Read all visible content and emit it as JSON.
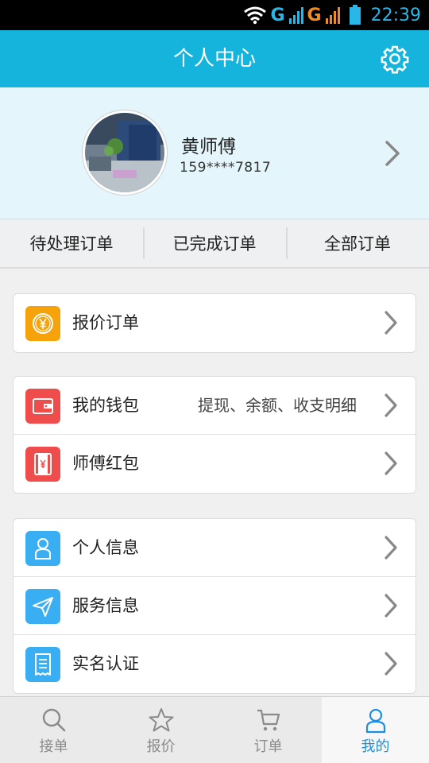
{
  "status_bar": {
    "network_1": "G",
    "network_2": "G",
    "time": "22:39"
  },
  "header": {
    "title": "个人中心",
    "settings_icon": "gear-icon"
  },
  "profile": {
    "name": "黄师傅",
    "phone": "159****7817"
  },
  "order_tabs": [
    {
      "label": "待处理订单"
    },
    {
      "label": "已完成订单"
    },
    {
      "label": "全部订单"
    }
  ],
  "groups": [
    {
      "items": [
        {
          "label": "报价订单",
          "icon": "yen-coin-icon",
          "color": "#f5a20b"
        }
      ]
    },
    {
      "items": [
        {
          "label": "我的钱包",
          "hint": "提现、余额、收支明细",
          "icon": "wallet-icon",
          "color": "#ef4c4c"
        },
        {
          "label": "师傅红包",
          "icon": "red-envelope-icon",
          "color": "#ef4c4c"
        }
      ]
    },
    {
      "items": [
        {
          "label": "个人信息",
          "icon": "person-icon",
          "color": "#3aaef2"
        },
        {
          "label": "服务信息",
          "icon": "paper-plane-icon",
          "color": "#3aaef2"
        },
        {
          "label": "实名认证",
          "icon": "receipt-icon",
          "color": "#3aaef2"
        }
      ]
    }
  ],
  "tab_bar": [
    {
      "label": "接单",
      "icon": "search-icon",
      "active": false
    },
    {
      "label": "报价",
      "icon": "star-icon",
      "active": false
    },
    {
      "label": "订单",
      "icon": "cart-icon",
      "active": false
    },
    {
      "label": "我的",
      "icon": "person-icon",
      "active": true
    }
  ],
  "colors": {
    "header_bg": "#14b4dc",
    "profile_bg": "#e4f6fc",
    "active_tab": "#1d8fe0"
  }
}
